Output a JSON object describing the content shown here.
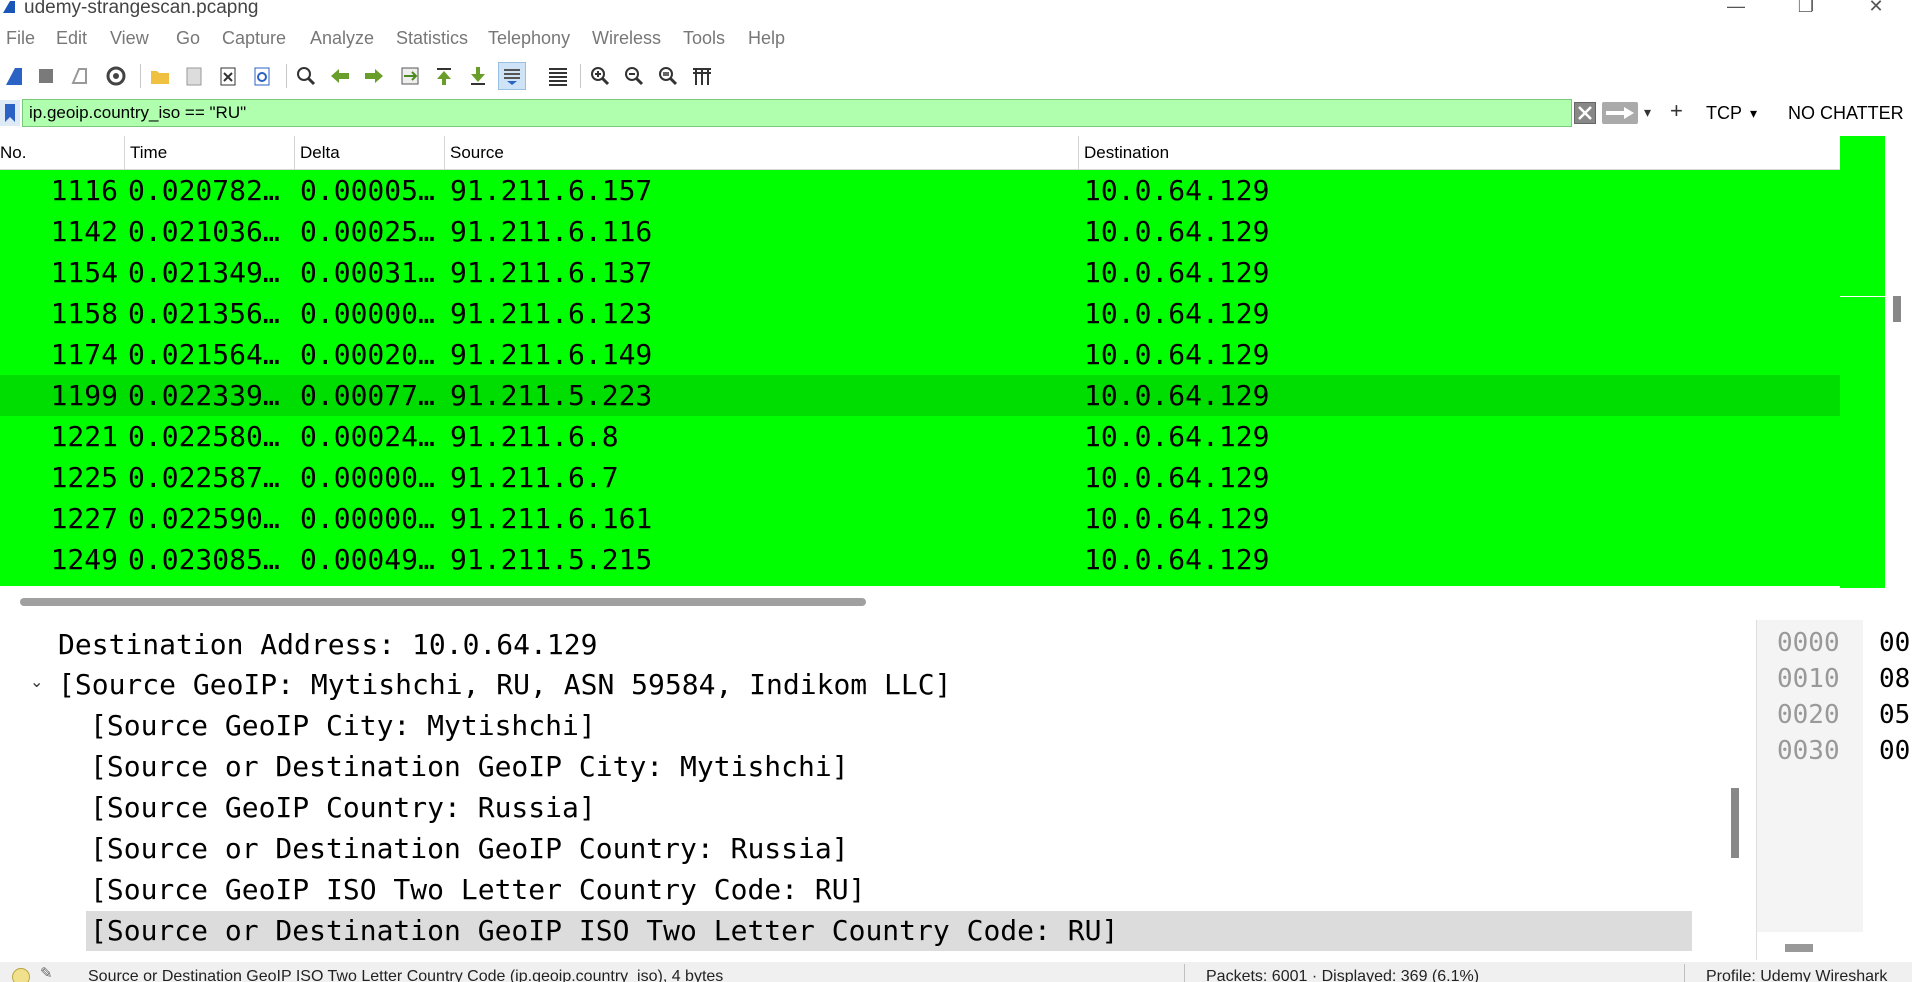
{
  "window": {
    "title": "udemy-strangescan.pcapng",
    "controls": [
      "—",
      "❐",
      "✕"
    ]
  },
  "menu": [
    "File",
    "Edit",
    "View",
    "Go",
    "Capture",
    "Analyze",
    "Statistics",
    "Telephony",
    "Wireless",
    "Tools",
    "Help"
  ],
  "toolbar": {
    "icons": [
      "start-capture-icon",
      "stop-capture-icon",
      "restart-capture-icon",
      "capture-options-icon",
      "open-file-icon",
      "save-file-icon",
      "close-file-icon",
      "reload-file-icon",
      "find-packet-icon",
      "go-back-icon",
      "go-forward-icon",
      "go-to-packet-icon",
      "first-packet-icon",
      "last-packet-icon",
      "autoscroll-icon",
      "colorize-icon",
      "zoom-in-icon",
      "zoom-out-icon",
      "zoom-normal-icon",
      "resize-columns-icon"
    ]
  },
  "filter": {
    "value": "ip.geoip.country_iso == \"RU\"",
    "plus": "+",
    "button1": "TCP",
    "button2": "NO CHATTER"
  },
  "packet_list": {
    "columns": [
      "No.",
      "Time",
      "Delta",
      "Source",
      "Destination"
    ],
    "rows": [
      {
        "no": "1116",
        "time": "0.020782…",
        "delta": "0.00005…",
        "source": "91.211.6.157",
        "destination": "10.0.64.129"
      },
      {
        "no": "1142",
        "time": "0.021036…",
        "delta": "0.00025…",
        "source": "91.211.6.116",
        "destination": "10.0.64.129"
      },
      {
        "no": "1154",
        "time": "0.021349…",
        "delta": "0.00031…",
        "source": "91.211.6.137",
        "destination": "10.0.64.129"
      },
      {
        "no": "1158",
        "time": "0.021356…",
        "delta": "0.00000…",
        "source": "91.211.6.123",
        "destination": "10.0.64.129"
      },
      {
        "no": "1174",
        "time": "0.021564…",
        "delta": "0.00020…",
        "source": "91.211.6.149",
        "destination": "10.0.64.129"
      },
      {
        "no": "1199",
        "time": "0.022339…",
        "delta": "0.00077…",
        "source": "91.211.5.223",
        "destination": "10.0.64.129"
      },
      {
        "no": "1221",
        "time": "0.022580…",
        "delta": "0.00024…",
        "source": "91.211.6.8",
        "destination": "10.0.64.129"
      },
      {
        "no": "1225",
        "time": "0.022587…",
        "delta": "0.00000…",
        "source": "91.211.6.7",
        "destination": "10.0.64.129"
      },
      {
        "no": "1227",
        "time": "0.022590…",
        "delta": "0.00000…",
        "source": "91.211.6.161",
        "destination": "10.0.64.129"
      },
      {
        "no": "1249",
        "time": "0.023085…",
        "delta": "0.00049…",
        "source": "91.211.5.215",
        "destination": "10.0.64.129"
      }
    ],
    "selected_row_no": "1199",
    "row_color": "#00ff00"
  },
  "details": {
    "lines": [
      "Destination Address: 10.0.64.129",
      "[Source GeoIP: Mytishchi, RU, ASN 59584, Indikom LLC]",
      "[Source GeoIP City: Mytishchi]",
      "[Source or Destination GeoIP City: Mytishchi]",
      "[Source GeoIP Country: Russia]",
      "[Source or Destination GeoIP Country: Russia]",
      "[Source GeoIP ISO Two Letter Country Code: RU]",
      "[Source or Destination GeoIP ISO Two Letter Country Code: RU]"
    ],
    "expander": "⌄"
  },
  "bytes": {
    "offsets": [
      "0000",
      "0010",
      "0020",
      "0030"
    ],
    "values": [
      "00",
      "08",
      "05",
      "00"
    ]
  },
  "status": {
    "field_info": "Source or Destination GeoIP ISO Two Letter Country Code (ip.geoip.country_iso), 4 bytes",
    "packets": "Packets: 6001 · Displayed: 369 (6.1%)",
    "profile": "Profile: Udemy Wireshark"
  }
}
